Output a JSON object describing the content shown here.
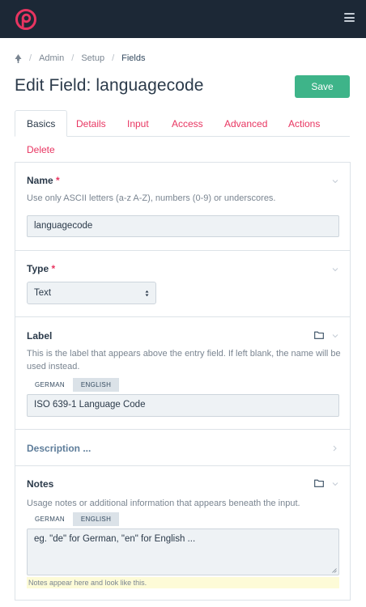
{
  "app": {
    "brand_color": "#e83561",
    "topbar_color": "#1c2836",
    "logo_icon": "processwire-logo-icon",
    "menu_icon": "hamburger-menu-icon"
  },
  "breadcrumb": {
    "home_icon": "tree-icon",
    "items": [
      "Admin",
      "Setup",
      "Fields"
    ]
  },
  "page": {
    "title": "Edit Field: languagecode",
    "save_label": "Save",
    "save_color": "#3eb489"
  },
  "tabs": [
    "Basics",
    "Details",
    "Input",
    "Access",
    "Advanced",
    "Actions",
    "Delete"
  ],
  "active_tab": "Basics",
  "fields": {
    "name": {
      "label": "Name",
      "required_mark": "*",
      "description": "Use only ASCII letters (a-z A-Z), numbers (0-9) or underscores.",
      "value": "languagecode"
    },
    "type": {
      "label": "Type",
      "required_mark": "*",
      "selected": "Text"
    },
    "label": {
      "label": "Label",
      "description": "This is the label that appears above the entry field. If left blank, the name will be used instead.",
      "languages": [
        "GERMAN",
        "ENGLISH"
      ],
      "active_language": "ENGLISH",
      "value": "ISO 639-1 Language Code"
    },
    "description": {
      "label": "Description ..."
    },
    "notes": {
      "label": "Notes",
      "description": "Usage notes or additional information that appears beneath the input.",
      "languages": [
        "GERMAN",
        "ENGLISH"
      ],
      "active_language": "ENGLISH",
      "value": "eg. \"de\" for German, \"en\" for English ...",
      "note": "Notes appear here and look like this."
    }
  }
}
